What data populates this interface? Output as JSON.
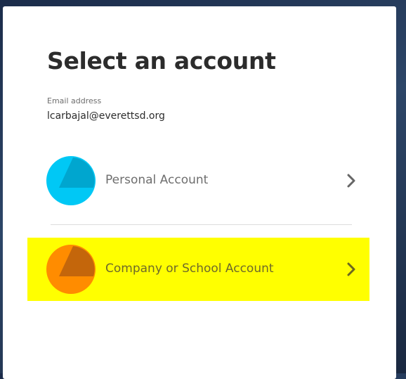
{
  "page": {
    "title": "Select an account"
  },
  "email": {
    "label": "Email address",
    "value": "lcarbajal@everettsd.org"
  },
  "accounts": [
    {
      "label": "Personal Account",
      "icon": "personal-account-icon",
      "color": "#00c8f5",
      "highlighted": false
    },
    {
      "label": "Company or School Account",
      "icon": "company-account-icon",
      "color": "#ff8c00",
      "highlighted": true,
      "highlight_color": "#ffff00"
    }
  ],
  "colors": {
    "background": "#1b2c4a",
    "card": "#ffffff",
    "title_text": "#2c2c2c",
    "muted_text": "#6e6e6e"
  }
}
